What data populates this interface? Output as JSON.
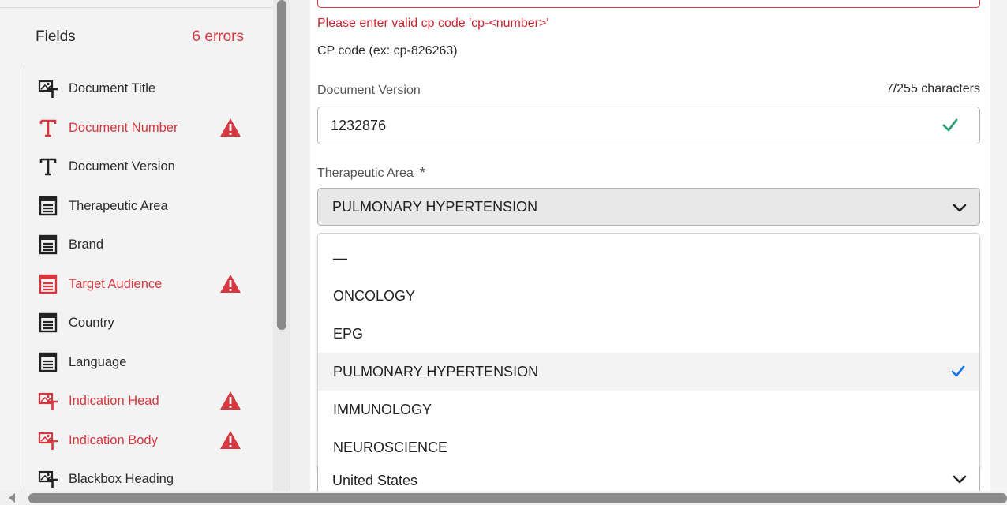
{
  "sidebar": {
    "title": "Fields",
    "error_count": "6 errors",
    "items": [
      {
        "label": "Document Title",
        "icon": "image-text-icon",
        "error": false
      },
      {
        "label": "Document Number",
        "icon": "text-icon",
        "error": true
      },
      {
        "label": "Document Version",
        "icon": "text-icon",
        "error": false
      },
      {
        "label": "Therapeutic Area",
        "icon": "list-icon",
        "error": false
      },
      {
        "label": "Brand",
        "icon": "list-icon",
        "error": false
      },
      {
        "label": "Target Audience",
        "icon": "list-icon",
        "error": true
      },
      {
        "label": "Country",
        "icon": "list-icon",
        "error": false
      },
      {
        "label": "Language",
        "icon": "list-icon",
        "error": false
      },
      {
        "label": "Indication Head",
        "icon": "image-text-icon",
        "error": true
      },
      {
        "label": "Indication Body",
        "icon": "image-text-icon",
        "error": true
      },
      {
        "label": "Blackbox Heading",
        "icon": "image-text-icon",
        "error": false
      }
    ]
  },
  "form": {
    "cp_code": {
      "error": "Please enter valid cp code 'cp-<number>'",
      "help": "CP code (ex: cp-826263)"
    },
    "document_version": {
      "label": "Document Version",
      "char_count": "7/255 characters",
      "value": "1232876"
    },
    "therapeutic_area": {
      "label": "Therapeutic Area",
      "required_mark": "*",
      "value": "PULMONARY HYPERTENSION",
      "options": [
        "—",
        "ONCOLOGY",
        "EPG",
        "PULMONARY HYPERTENSION",
        "IMMUNOLOGY",
        "NEUROSCIENCE"
      ],
      "selected_index": 3
    },
    "country": {
      "value": "United States"
    }
  },
  "colors": {
    "error": "#d7373f",
    "valid": "#2d9d78",
    "selected_check": "#1473e6"
  }
}
